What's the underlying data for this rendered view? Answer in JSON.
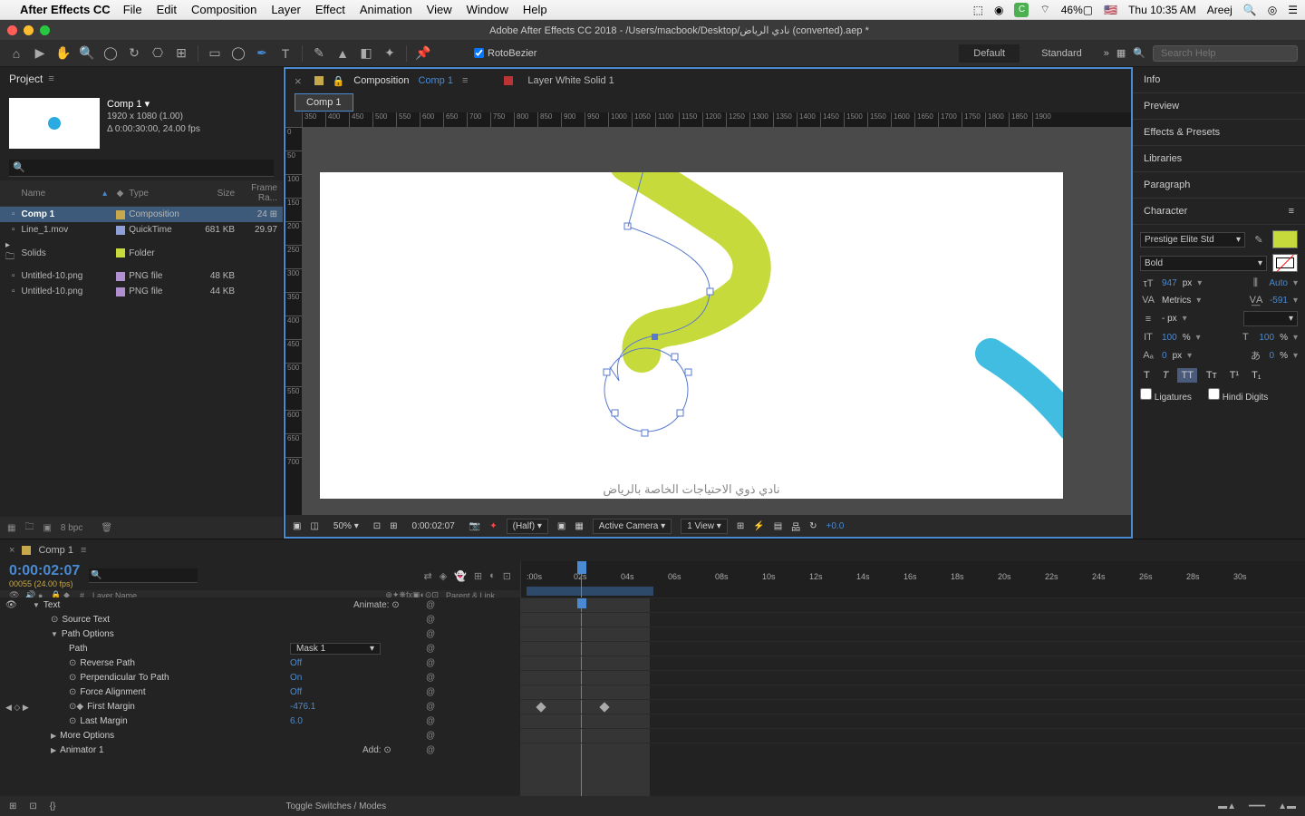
{
  "menubar": {
    "app_name": "After Effects CC",
    "items": [
      "File",
      "Edit",
      "Composition",
      "Layer",
      "Effect",
      "Animation",
      "View",
      "Window",
      "Help"
    ],
    "battery": "46%",
    "clock": "Thu 10:35 AM",
    "user": "Areej"
  },
  "window": {
    "title": "Adobe After Effects CC 2018 - /Users/macbook/Desktop/نادي الرياض (converted).aep *"
  },
  "toolbar": {
    "rotobezier": "RotoBezier",
    "workspaces": [
      "Default",
      "Standard"
    ],
    "search_placeholder": "Search Help"
  },
  "project": {
    "tab": "Project",
    "comp_name": "Comp 1 ▾",
    "dims": "1920 x 1080 (1.00)",
    "duration": "Δ 0:00:30:00, 24.00 fps",
    "cols": {
      "name": "Name",
      "type": "Type",
      "size": "Size",
      "fr": "Frame Ra..."
    },
    "rows": [
      {
        "name": "Comp 1",
        "type": "Composition",
        "size": "",
        "fr": "24",
        "tag": "#c7a84a",
        "selected": true
      },
      {
        "name": "Line_1.mov",
        "type": "QuickTime",
        "size": "681 KB",
        "fr": "29.97",
        "tag": "#8fa0d8"
      },
      {
        "name": "Solids",
        "type": "Folder",
        "size": "",
        "fr": "",
        "tag": "#c7da3c",
        "folder": true
      },
      {
        "name": "Untitled-10.png",
        "type": "PNG file",
        "size": "48 KB",
        "fr": "",
        "tag": "#b090d0"
      },
      {
        "name": "Untitled-10.png",
        "type": "PNG file",
        "size": "44 KB",
        "fr": "",
        "tag": "#b090d0"
      }
    ],
    "bpc": "8 bpc"
  },
  "comp": {
    "tab_prefix": "Composition",
    "tab_link": "Comp 1",
    "layer_tab": "Layer White Solid 1",
    "subtab": "Comp 1",
    "ruler_marks": [
      350,
      400,
      450,
      500,
      550,
      600,
      650,
      700,
      750,
      800,
      850,
      900,
      950,
      1000,
      1050,
      1100,
      1150,
      1200,
      1250,
      1300,
      1350,
      1400,
      1450,
      1500,
      1550,
      1600,
      1650,
      1700,
      1750,
      1800,
      1850,
      1900
    ],
    "ruler_v": [
      0,
      50,
      100,
      150,
      200,
      250,
      300,
      350,
      400,
      450,
      500,
      550,
      600,
      650,
      700
    ],
    "arabic_caption": "نادي ذوي الاحتياجات الخاصة بالرياض",
    "footer": {
      "zoom": "50%",
      "time": "0:00:02:07",
      "res": "(Half)",
      "camera": "Active Camera",
      "views": "1 View",
      "exposure": "+0.0"
    }
  },
  "right": {
    "panels": [
      "Info",
      "Preview",
      "Effects & Presets",
      "Libraries",
      "Paragraph"
    ],
    "character": {
      "title": "Character",
      "font": "Prestige Elite Std",
      "style": "Bold",
      "size": "947",
      "size_unit": "px",
      "leading": "Auto",
      "kerning": "Metrics",
      "tracking": "-591",
      "stroke": "- px",
      "vscale": "100",
      "vscale_unit": "%",
      "hscale": "100",
      "hscale_unit": "%",
      "baseline": "0",
      "baseline_unit": "px",
      "tsume": "0",
      "tsume_unit": "%",
      "ligatures": "Ligatures",
      "hindi": "Hindi Digits"
    }
  },
  "timeline": {
    "tab": "Comp 1",
    "timecode": "0:00:02:07",
    "subtime": "00055 (24.00 fps)",
    "layer_header": "Layer Name",
    "parent_header": "Parent & Link",
    "seconds": [
      ":00s",
      "02s",
      "04s",
      "06s",
      "08s",
      "10s",
      "12s",
      "14s",
      "16s",
      "18s",
      "20s",
      "22s",
      "24s",
      "26s",
      "28s",
      "30s"
    ],
    "rows": [
      {
        "indent": 30,
        "tri": "▼",
        "name": "Text",
        "animate": "Animate:"
      },
      {
        "indent": 50,
        "stop": true,
        "name": "Source Text"
      },
      {
        "indent": 50,
        "tri": "▼",
        "name": "Path Options"
      },
      {
        "indent": 70,
        "name": "Path",
        "val": "Mask 1",
        "dd": true
      },
      {
        "indent": 70,
        "stop": true,
        "name": "Reverse Path",
        "val": "Off"
      },
      {
        "indent": 70,
        "stop": true,
        "name": "Perpendicular To Path",
        "val": "On"
      },
      {
        "indent": 70,
        "stop": true,
        "name": "Force Alignment",
        "val": "Off"
      },
      {
        "indent": 70,
        "stop": true,
        "kf": true,
        "name": "First Margin",
        "val": "-476.1"
      },
      {
        "indent": 70,
        "stop": true,
        "name": "Last Margin",
        "val": "6.0"
      },
      {
        "indent": 50,
        "tri": "▶",
        "name": "More Options"
      },
      {
        "indent": 50,
        "tri": "▶",
        "name": "Animator 1",
        "animate2": true
      }
    ],
    "toggle": "Toggle Switches / Modes"
  }
}
